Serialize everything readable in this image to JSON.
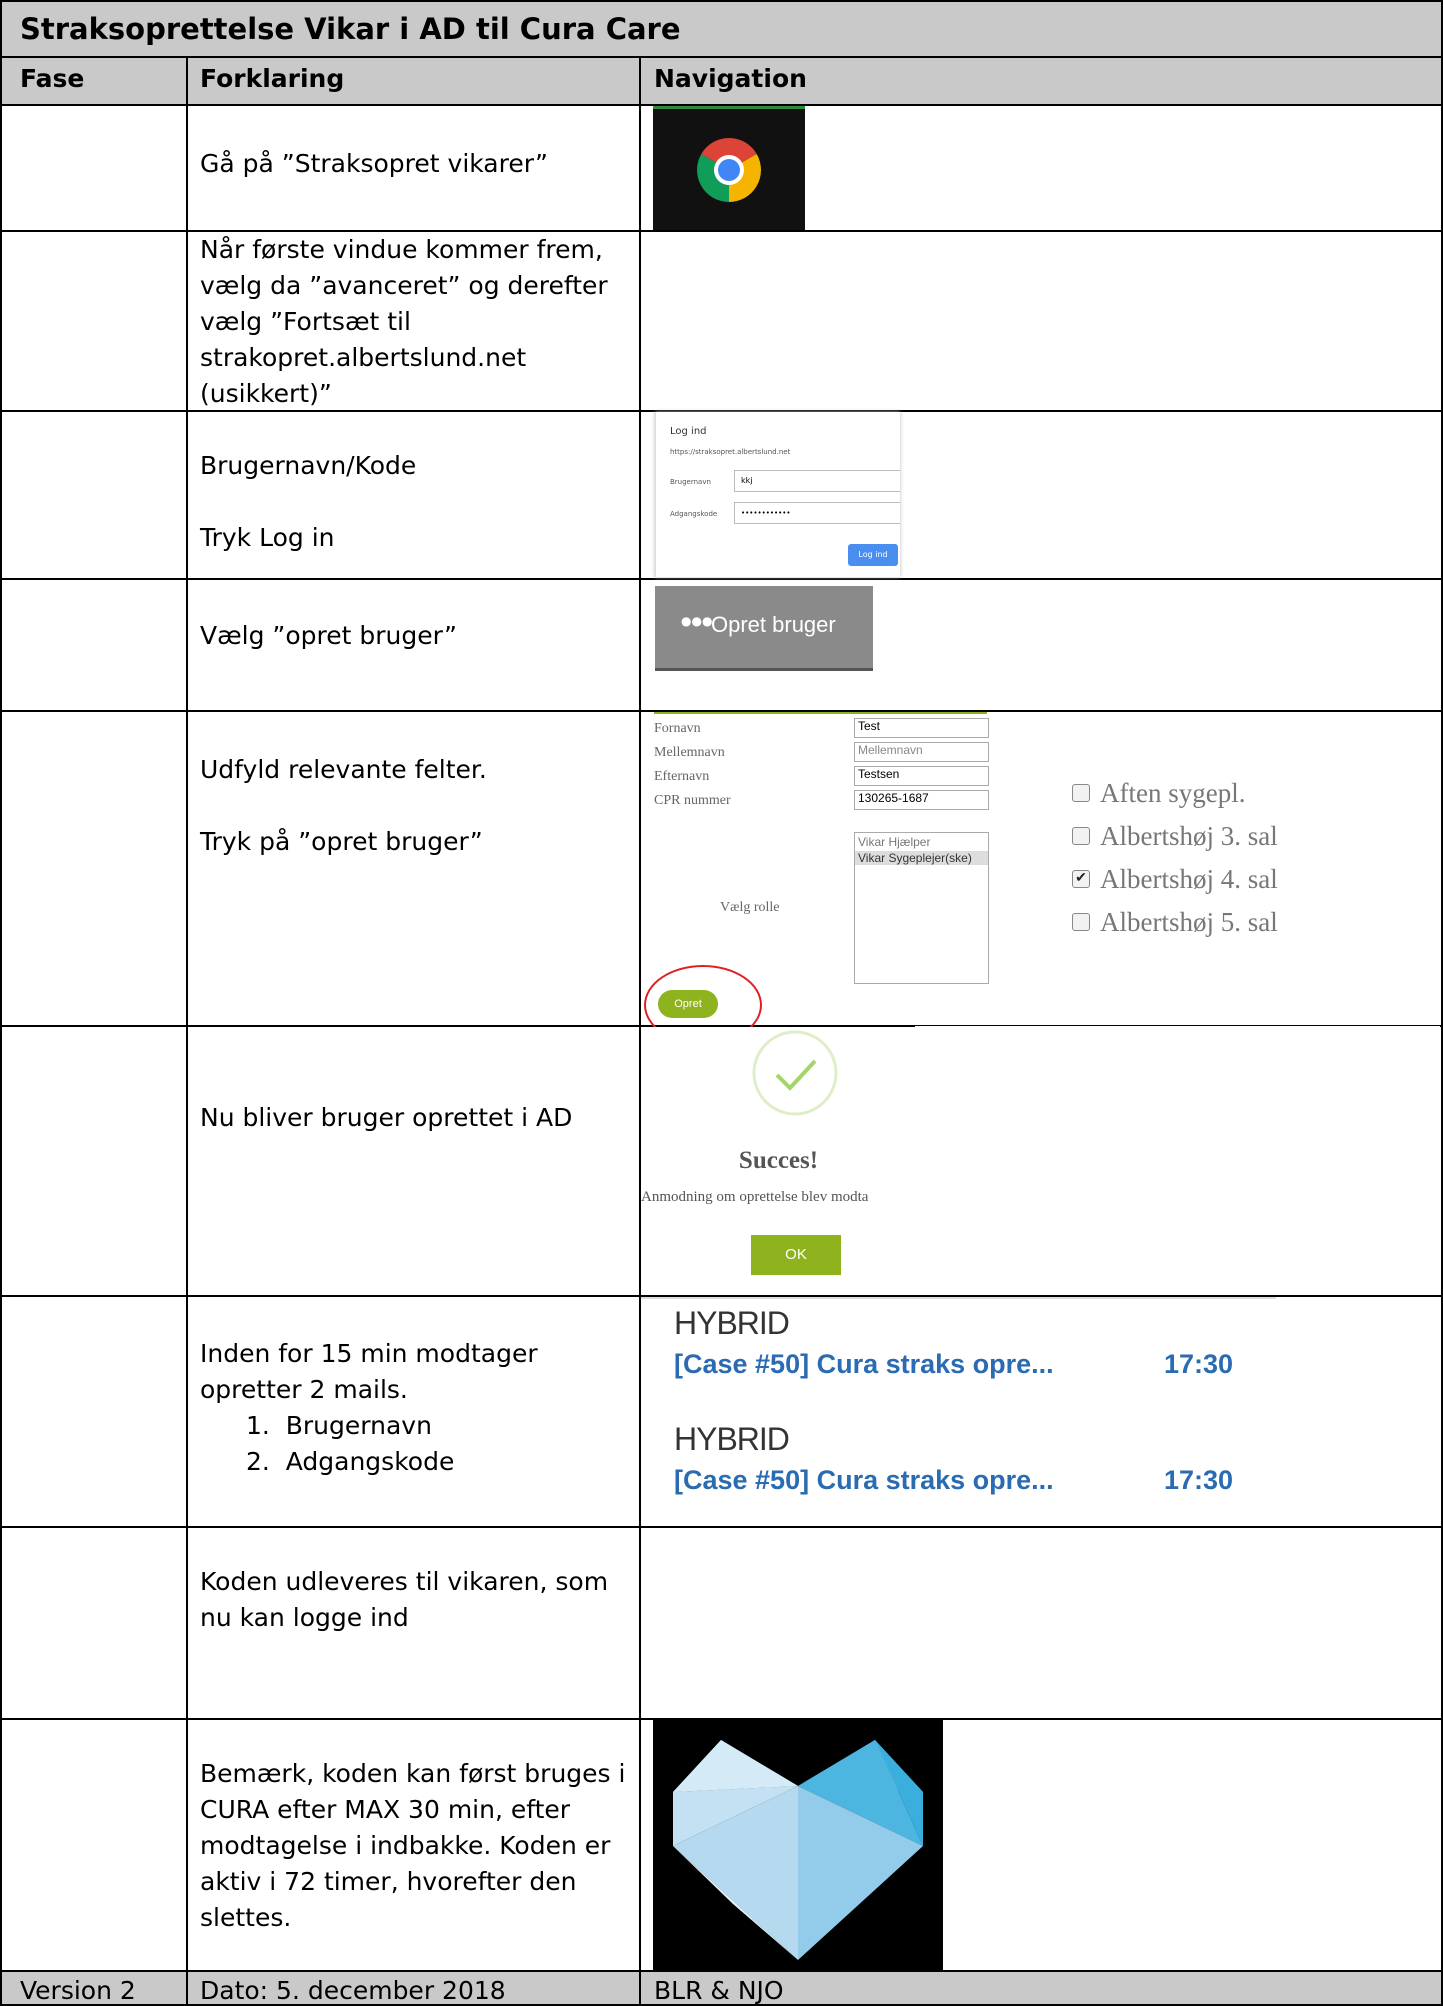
{
  "title": "Straksoprettelse Vikar i AD til Cura Care",
  "headers": {
    "fase": "Fase",
    "forklaring": "Forklaring",
    "navigation": "Navigation"
  },
  "rows": [
    {
      "text": "Gå på ”Straksopret vikarer”",
      "icon": "chrome-icon"
    },
    {
      "text": "Når første vindue kommer frem, vælg da ”avanceret” og derefter vælg ”Fortsæt til strakopret.albertslund.net (usikkert)”"
    },
    {
      "line1": "Brugernavn/Kode",
      "line2": "Tryk Log in"
    },
    {
      "text": "Vælg ”opret bruger”"
    },
    {
      "line1": "Udfyld relevante felter.",
      "line2": "Tryk på ”opret bruger”"
    },
    {
      "text": "Nu bliver bruger oprettet i AD"
    },
    {
      "text": "Inden for 15 min modtager opretter 2 mails.",
      "items": [
        "1.  Brugernavn",
        "2.  Adgangskode"
      ]
    },
    {
      "text": "Koden udleveres til vikaren, som nu kan logge ind"
    },
    {
      "text": "Bemærk, koden kan først bruges i CURA efter MAX 30 min, efter modtagelse i indbakke. Koden er aktiv i 72 timer, hvorefter den slettes.",
      "icon": "cura-heart-logo"
    }
  ],
  "login": {
    "title": "Log ind",
    "url": "https://straksopret.albertslund.net",
    "user_label": "Brugernavn",
    "user_value": "kkj",
    "pass_label": "Adgangskode",
    "pass_value": "••••••••••••",
    "button": "Log ind",
    "button_color": "#4a8ef0"
  },
  "opret_button": {
    "label": "Opret bruger",
    "icon": "users-icon",
    "bg": "#8a8a8a"
  },
  "form": {
    "fields": [
      {
        "label": "Fornavn",
        "value": "Test",
        "placeholder": false
      },
      {
        "label": "Mellemnavn",
        "value": "Mellemnavn",
        "placeholder": true
      },
      {
        "label": "Efternavn",
        "value": "Testsen",
        "placeholder": false
      },
      {
        "label": "CPR nummer",
        "value": "130265-1687",
        "placeholder": false
      }
    ],
    "role_label": "Vælg rolle",
    "roles": [
      "Vikar Hjælper",
      "Vikar Sygeplejer(ske)"
    ],
    "submit": "Opret bruger",
    "submit_color": "#8fb31e",
    "highlight_color": "#e02020",
    "checkboxes": [
      {
        "label": "Aften sygepl.",
        "checked": false
      },
      {
        "label": "Albertshøj 3. sal",
        "checked": false
      },
      {
        "label": "Albertshøj 4. sal",
        "checked": true
      },
      {
        "label": "Albertshøj 5. sal",
        "checked": false
      }
    ]
  },
  "success": {
    "title": "Succes!",
    "message": "Anmodning om oprettelse blev modta",
    "ok": "OK",
    "ok_color": "#8fb31e"
  },
  "mails": [
    {
      "sender": "HYBRID",
      "subject": "[Case #50] Cura straks opre...",
      "time": "17:30"
    },
    {
      "sender": "HYBRID",
      "subject": "[Case #50] Cura straks opre...",
      "time": "17:30"
    }
  ],
  "footer": {
    "version": "Version 2",
    "date": "Dato: 5. december 2018",
    "authors": "BLR & NJO"
  }
}
